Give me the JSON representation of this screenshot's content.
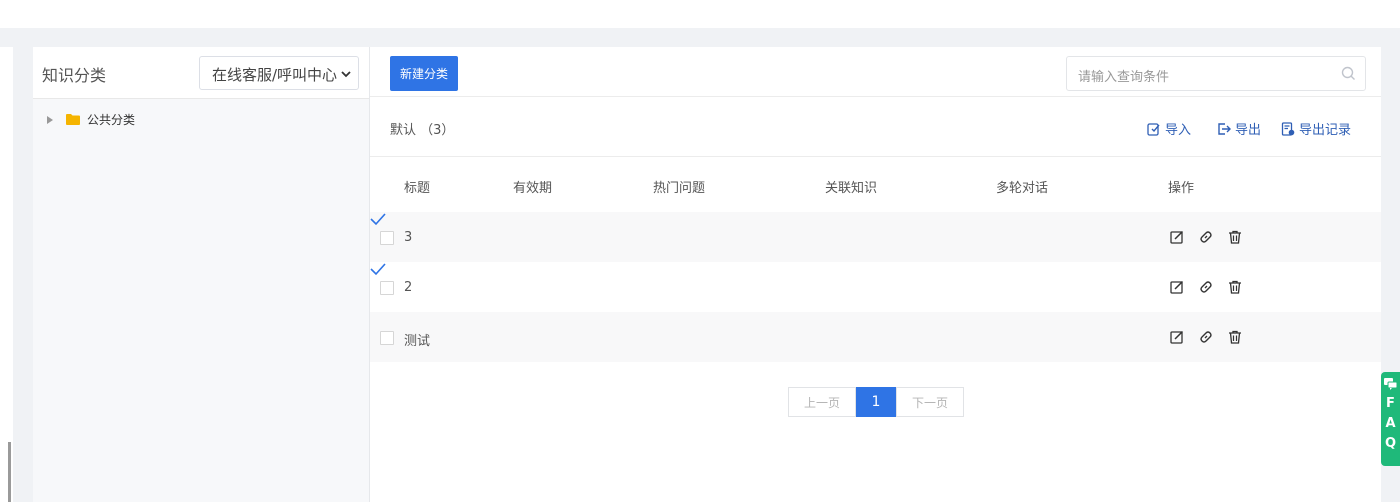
{
  "sidebar": {
    "title": "知识分类",
    "select_value": "在线客服/呼叫中心",
    "tree": [
      {
        "label": "公共分类"
      }
    ]
  },
  "toolbar": {
    "new_label": "新建分类",
    "search_placeholder": "请输入查询条件"
  },
  "subbar": {
    "crumb": "默认 （3）",
    "actions": [
      {
        "label": "导入",
        "icon": "import-icon"
      },
      {
        "label": "导出",
        "icon": "export-icon"
      },
      {
        "label": "导出记录",
        "icon": "export-record-icon"
      }
    ]
  },
  "table": {
    "columns": [
      "标题",
      "有效期",
      "热门问题",
      "关联知识",
      "多轮对话",
      "操作"
    ],
    "rows": [
      {
        "title": "3",
        "hot": true
      },
      {
        "title": "2",
        "hot": true
      },
      {
        "title": "测试",
        "hot": false
      }
    ]
  },
  "pager": {
    "prev": "上一页",
    "current": "1",
    "next": "下一页"
  },
  "faq": [
    "F",
    "A",
    "Q"
  ],
  "colors": {
    "accent": "#2f74e5",
    "faq": "#1fb97a",
    "folder": "#f5b400"
  }
}
